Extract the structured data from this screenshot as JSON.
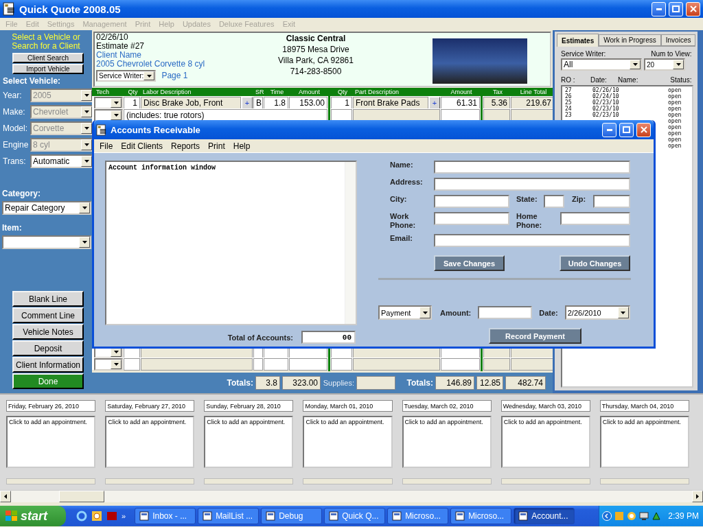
{
  "window": {
    "title": "Quick Quote 2008.05"
  },
  "menu": [
    {
      "label": "File",
      "disabled": true
    },
    {
      "label": "Edit",
      "disabled": true
    },
    {
      "label": "Settings",
      "disabled": true
    },
    {
      "label": "Management",
      "disabled": true
    },
    {
      "label": "Print",
      "disabled": true
    },
    {
      "label": "Help",
      "disabled": true
    },
    {
      "label": "Updates",
      "disabled": true
    },
    {
      "label": "Deluxe Features",
      "disabled": true
    },
    {
      "label": "Exit",
      "disabled": true
    }
  ],
  "sidebar": {
    "prompt": "Select a Vehicle or Search for a Client",
    "buttons": [
      "Client Search",
      "Import Vehicle"
    ],
    "heading": "Select Vehicle:",
    "fields": [
      {
        "label": "Year:",
        "value": "2005",
        "disabled": true
      },
      {
        "label": "Make:",
        "value": "Chevrolet",
        "disabled": true
      },
      {
        "label": "Model:",
        "value": "Corvette",
        "disabled": true
      },
      {
        "label": "Engine",
        "value": "8 cyl",
        "disabled": true
      },
      {
        "label": "Trans:",
        "value": "Automatic",
        "disabled": false
      }
    ],
    "category": {
      "label": "Category:",
      "value": "Repair Category"
    },
    "item": {
      "label": "Item:"
    },
    "actions": [
      {
        "label": "Blank Line",
        "kind": "plain"
      },
      {
        "label": "Comment Line",
        "kind": "plain"
      },
      {
        "label": "Vehicle Notes",
        "kind": "plain"
      },
      {
        "label": "Deposit",
        "kind": "plain"
      },
      {
        "label": "Client Information",
        "kind": "plain"
      },
      {
        "label": "Done",
        "kind": "primary"
      }
    ]
  },
  "estimate": {
    "date": "02/26/10",
    "number": "Estimate #27",
    "client": "Client Name",
    "vehicle": "2005 Chevrolet Corvette 8 cyl",
    "service_writer_label": "Service Writer:",
    "page": "Page 1",
    "shop": {
      "name": "Classic Central",
      "address": "18975 Mesa Drive",
      "city": "Villa Park, CA 92861",
      "phone": "714-283-8500"
    }
  },
  "grid": {
    "columns": [
      "Tech",
      "Qty",
      "Labor Description",
      "SR",
      "Time",
      "Amount",
      "Qty",
      "Part Description",
      "Amount",
      "Tax",
      "Line Total"
    ],
    "rows": [
      {
        "kind": "item",
        "qty": "1",
        "labor": "Disc Brake Job, Front",
        "add": "+",
        "sr": "B",
        "time": "1.8",
        "amount": "153.00",
        "part_qty": "1",
        "part": "Front Brake Pads",
        "part_add": "+",
        "part_amount": "61.31",
        "tax": "5.36",
        "line_total": "219.67"
      },
      {
        "kind": "comment",
        "text": "(includes: true rotors)"
      }
    ],
    "bottom_rows": [
      {
        "kind": "blank"
      },
      {
        "kind": "blank"
      }
    ]
  },
  "totals": {
    "labor_label": "Totals:",
    "time": "3.8",
    "labor_amount": "323.00",
    "supplies_label": "Supplies:",
    "parts_label": "Totals:",
    "parts_amount": "146.89",
    "tax": "12.85",
    "line_total": "482.74"
  },
  "history": {
    "tabs": [
      {
        "label": "Estimates",
        "selected": true
      },
      {
        "label": "Work in Progress",
        "selected": false
      },
      {
        "label": "Invoices",
        "selected": false
      }
    ],
    "service_writer_label": "Service Writer:",
    "num_label": "Num to View:",
    "service_writer": "All",
    "num": "20",
    "columns": [
      "RO :",
      "Date:",
      "Name:",
      "Status:"
    ],
    "rows": [
      {
        "ro": "27",
        "date": "02/26/10",
        "status": "open"
      },
      {
        "ro": "26",
        "date": "02/24/10",
        "status": "open"
      },
      {
        "ro": "25",
        "date": "02/23/10",
        "status": "open"
      },
      {
        "ro": "24",
        "date": "02/23/10",
        "status": "open"
      },
      {
        "ro": "23",
        "date": "02/23/10",
        "status": "open"
      },
      {
        "status": "open"
      },
      {
        "status": "open"
      },
      {
        "status": "open"
      },
      {
        "status": "open"
      },
      {
        "status": "open"
      }
    ]
  },
  "calendar": [
    {
      "date": "Friday, February 26, 2010",
      "text": "Click to add an appointment."
    },
    {
      "date": "Saturday, February 27, 2010",
      "text": "Click to add an appointment."
    },
    {
      "date": "Sunday, February 28, 2010",
      "text": "Click to add an appointment."
    },
    {
      "date": "Monday, March 01, 2010",
      "text": "Click to add an appointment."
    },
    {
      "date": "Tuesday, March 02, 2010",
      "text": "Click to add an appointment."
    },
    {
      "date": "Wednesday, March 03, 2010",
      "text": "Click to add an appointment."
    },
    {
      "date": "Thursday, March 04, 2010",
      "text": "Click to add an appointment."
    }
  ],
  "dialog": {
    "title": "Accounts Receivable",
    "menu": [
      "File",
      "Edit Clients",
      "Reports",
      "Print",
      "Help"
    ],
    "notes": "Account information window",
    "total_label": "Total of Accounts:",
    "total": "00",
    "form_rows": [
      {
        "fields": [
          {
            "label": "Name:"
          }
        ]
      },
      {
        "fields": [
          {
            "label": "Address:"
          }
        ]
      },
      {
        "fields": [
          {
            "label": "City:"
          },
          {
            "label": "State:"
          },
          {
            "label": "Zip:"
          }
        ]
      },
      {
        "fields": [
          {
            "label": "Work Phone:"
          },
          {
            "label": "Home Phone:"
          }
        ]
      },
      {
        "fields": [
          {
            "label": "Email:"
          }
        ]
      }
    ],
    "save": "Save Changes",
    "undo": "Undo Changes",
    "payment": {
      "type": "Payment",
      "amount_label": "Amount:",
      "date_label": "Date:",
      "date": "2/26/2010",
      "button": "Record Payment"
    }
  },
  "taskbar": {
    "start": "start",
    "more": "»",
    "tasks": [
      {
        "label": "Inbox - ...",
        "selected": false
      },
      {
        "label": "MailList ...",
        "selected": false
      },
      {
        "label": "Debug",
        "selected": false
      },
      {
        "label": "Quick Q...",
        "selected": false
      },
      {
        "label": "Microso...",
        "selected": false
      },
      {
        "label": "Microso...",
        "selected": false
      },
      {
        "label": "Account...",
        "selected": true
      }
    ],
    "clock": "2:39 PM"
  }
}
